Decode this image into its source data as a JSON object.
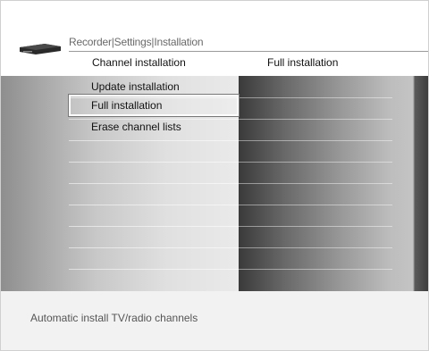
{
  "header": {
    "breadcrumb": "Recorder|Settings|Installation",
    "column_left_title": "Channel installation",
    "column_right_title": "Full installation"
  },
  "menu": {
    "items": [
      {
        "label": "Update installation",
        "selected": false
      },
      {
        "label": "Full installation",
        "selected": true
      },
      {
        "label": "Erase channel lists",
        "selected": false
      }
    ]
  },
  "footer": {
    "help_text": "Automatic install TV/radio channels"
  },
  "icons": {
    "device": "recorder-device-icon"
  }
}
